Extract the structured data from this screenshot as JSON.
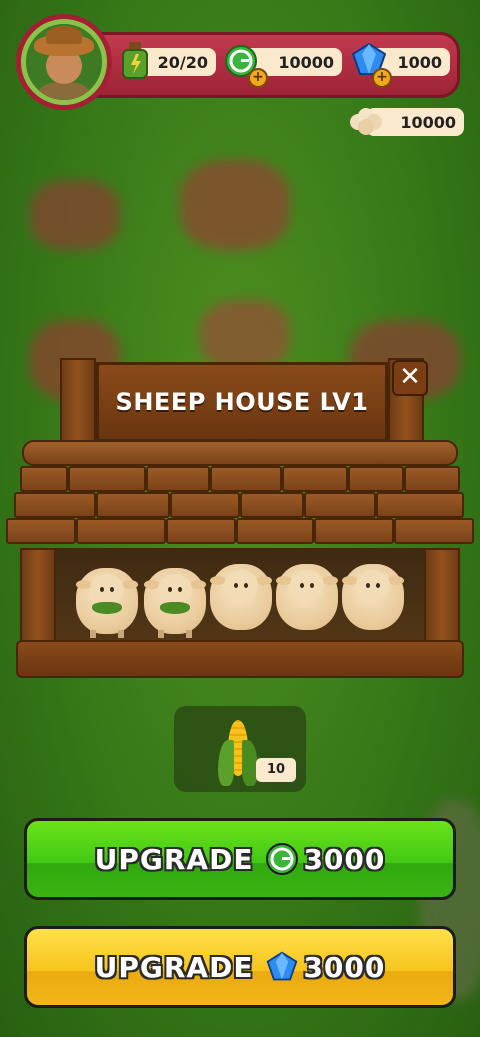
{
  "hud": {
    "energy": "20/20",
    "coins": "10000",
    "gems": "1000",
    "wool": "10000"
  },
  "building": {
    "title": "SHEEP HOUSE LV1",
    "close_icon": "close-icon",
    "sheep_count": 5,
    "sheep_eating": 2
  },
  "feed": {
    "item_icon": "corn-icon",
    "quantity": "10"
  },
  "actions": {
    "upgrade_coin_label": "UPGRADE",
    "upgrade_coin_cost": "3000",
    "upgrade_gem_label": "UPGRADE",
    "upgrade_gem_cost": "3000"
  },
  "colors": {
    "hud_bar": "#b12c42",
    "green_button": "#42c914",
    "yellow_button": "#f7c41c",
    "wood": "#7a4215"
  }
}
